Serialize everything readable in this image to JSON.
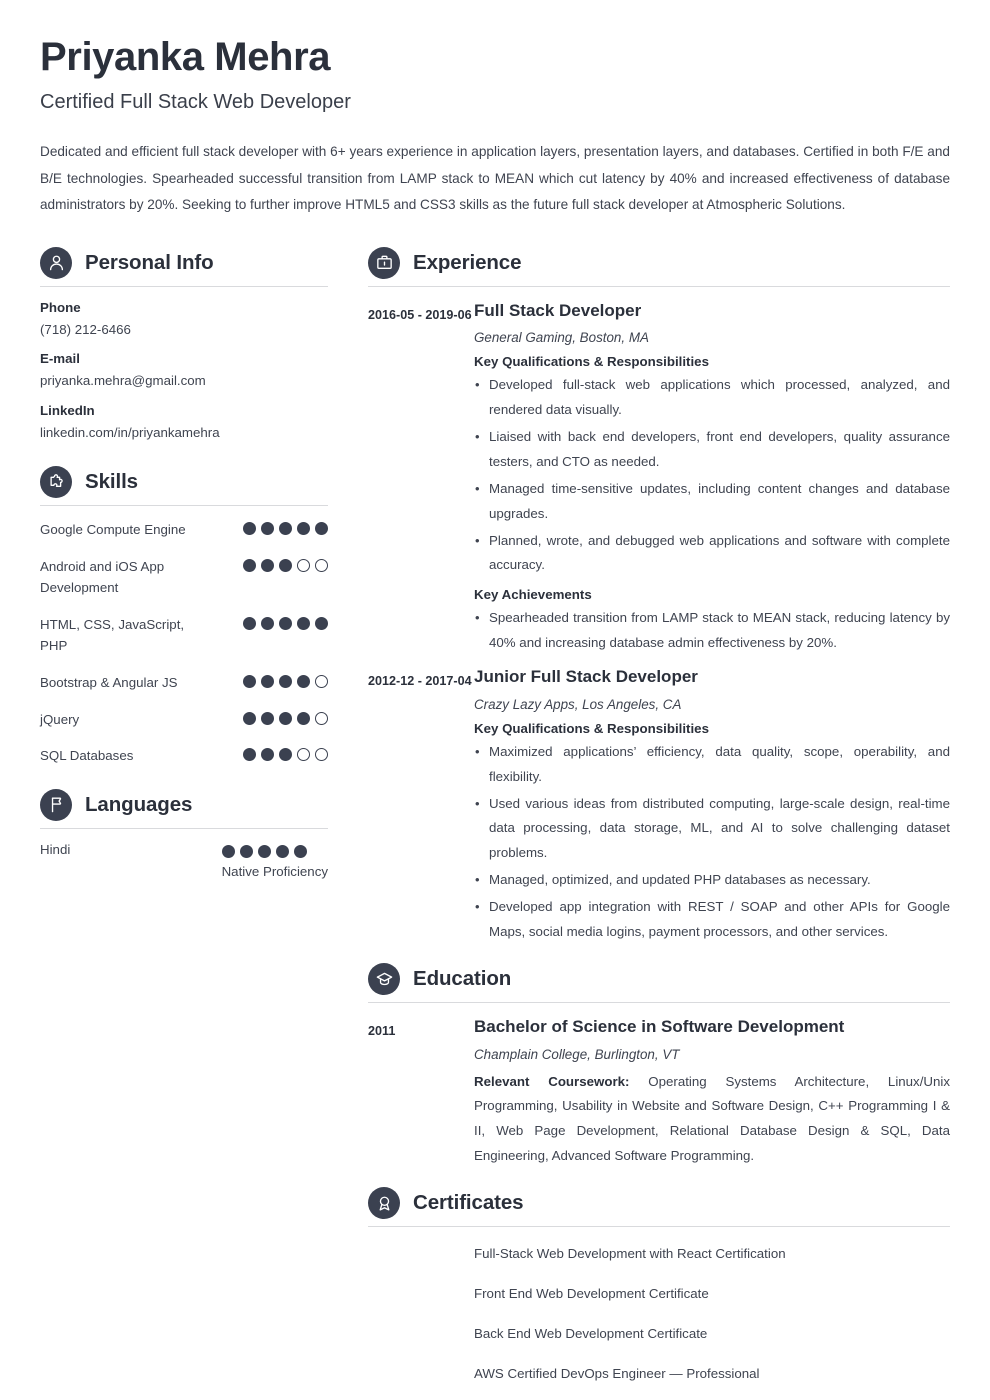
{
  "header": {
    "name": "Priyanka Mehra",
    "job_title": "Certified Full Stack Web Developer",
    "summary": "Dedicated and efficient full stack developer with 6+ years experience in application layers, presentation layers, and databases. Certified in both F/E and B/E technologies. Spearheaded successful transition from LAMP stack to MEAN which cut latency by 40% and increased effectiveness of database administrators by 20%. Seeking to further improve HTML5 and CSS3 skills as the future full stack developer at Atmospheric Solutions."
  },
  "colors": {
    "accent_dark": "#3b4150",
    "heading": "#2b303b",
    "body_text": "#3f4450",
    "divider": "#d9dadd"
  },
  "personal_info": {
    "section_title": "Personal Info",
    "icon": "user-icon",
    "fields": [
      {
        "label": "Phone",
        "value": "(718) 212-6466"
      },
      {
        "label": "E-mail",
        "value": "priyanka.mehra@gmail.com"
      },
      {
        "label": "LinkedIn",
        "value": "linkedin.com/in/priyankamehra"
      }
    ]
  },
  "skills": {
    "section_title": "Skills",
    "icon": "puzzle-piece-icon",
    "max_rating": 5,
    "items": [
      {
        "name": "Google Compute Engine",
        "rating": 5
      },
      {
        "name": "Android and iOS App Development",
        "rating": 3
      },
      {
        "name": "HTML, CSS, JavaScript, PHP",
        "rating": 5
      },
      {
        "name": "Bootstrap & Angular JS",
        "rating": 4
      },
      {
        "name": "jQuery",
        "rating": 4
      },
      {
        "name": "SQL Databases",
        "rating": 3
      }
    ]
  },
  "languages": {
    "section_title": "Languages",
    "icon": "flag-icon",
    "max_rating": 5,
    "items": [
      {
        "name": "Hindi",
        "rating": 5,
        "level": "Native Proficiency"
      }
    ]
  },
  "experience": {
    "section_title": "Experience",
    "icon": "briefcase-icon",
    "entries": [
      {
        "date": "2016-05 - 2019-06",
        "title": "Full Stack Developer",
        "org": "General Gaming, Boston, MA",
        "groups": [
          {
            "heading": "Key Qualifications & Responsibilities",
            "bullets": [
              "Developed full-stack web applications which processed, analyzed, and rendered data visually.",
              "Liaised with back end developers, front end developers, quality assurance testers, and CTO as needed.",
              "Managed time-sensitive updates, including content changes and database upgrades.",
              "Planned, wrote, and debugged web applications and software with complete accuracy."
            ]
          },
          {
            "heading": "Key Achievements",
            "bullets": [
              "Spearheaded transition from LAMP stack to MEAN stack, reducing latency by 40% and increasing database admin effectiveness by 20%."
            ]
          }
        ]
      },
      {
        "date": "2012-12 - 2017-04",
        "title": "Junior Full Stack Developer",
        "org": "Crazy Lazy Apps, Los Angeles, CA",
        "groups": [
          {
            "heading": "Key Qualifications & Responsibilities",
            "bullets": [
              "Maximized applications’ efficiency, data quality, scope, operability, and flexibility.",
              "Used various ideas from distributed computing, large-scale design, real-time data processing, data storage, ML, and AI to solve challenging dataset problems.",
              "Managed, optimized, and updated PHP databases as necessary.",
              "Developed app integration with REST / SOAP and other APIs for Google Maps, social media logins, payment processors, and other services."
            ]
          }
        ]
      }
    ]
  },
  "education": {
    "section_title": "Education",
    "icon": "graduation-cap-icon",
    "entries": [
      {
        "date": "2011",
        "title": "Bachelor of Science in Software Development",
        "org": "Champlain College, Burlington, VT",
        "coursework_label": "Relevant Coursework:",
        "coursework_text": " Operating Systems Architecture, Linux/Unix Programming, Usability in Website and Software Design, C++ Programming I & II, Web Page Development, Relational Database Design & SQL, Data Engineering, Advanced Software Programming."
      }
    ]
  },
  "certificates": {
    "section_title": "Certificates",
    "icon": "award-ribbon-icon",
    "items": [
      "Full-Stack Web Development with React Certification",
      "Front End Web Development Certificate",
      "Back End Web Development Certificate",
      "AWS Certified DevOps Engineer — Professional"
    ]
  }
}
